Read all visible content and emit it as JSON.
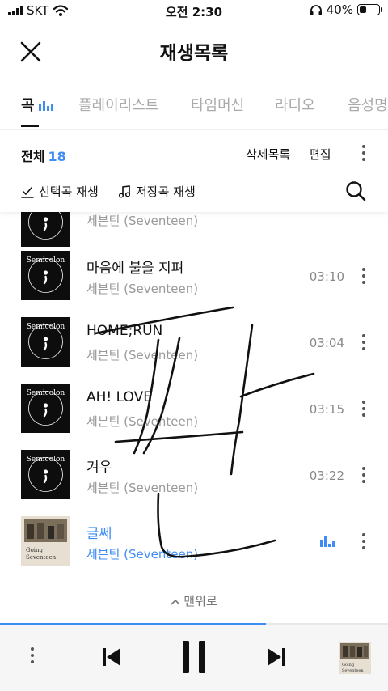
{
  "status_bar": {
    "carrier": "SKT",
    "time": "오전 2:30",
    "battery": "40%",
    "battery_level": 0.4
  },
  "header": {
    "title": "재생목록"
  },
  "tabs": [
    {
      "label": "곡",
      "active": true
    },
    {
      "label": "플레이리스트",
      "active": false
    },
    {
      "label": "타임머신",
      "active": false
    },
    {
      "label": "라디오",
      "active": false
    },
    {
      "label": "음성명",
      "active": false
    }
  ],
  "toolbar": {
    "count_label": "전체",
    "count": "18",
    "delete_label": "삭제목록",
    "edit_label": "편집"
  },
  "play_options": {
    "selected_play": "선택곡 재생",
    "saved_play": "저장곡 재생"
  },
  "songs": [
    {
      "title": "",
      "artist": "세븐틴 (Seventeen)",
      "duration": "",
      "cover": "semicolon"
    },
    {
      "title": "마음에 불을 지펴",
      "artist": "세븐틴 (Seventeen)",
      "duration": "03:10",
      "cover": "semicolon"
    },
    {
      "title": "HOME;RUN",
      "artist": "세븐틴 (Seventeen)",
      "duration": "03:04",
      "cover": "semicolon"
    },
    {
      "title": "AH! LOVE",
      "artist": "세븐틴 (Seventeen)",
      "duration": "03:15",
      "cover": "semicolon"
    },
    {
      "title": "겨우",
      "artist": "세븐틴 (Seventeen)",
      "duration": "03:22",
      "cover": "semicolon"
    },
    {
      "title": "글쎄",
      "artist": "세븐틴 (Seventeen)",
      "duration": "",
      "cover": "going-seventeen",
      "playing": true
    }
  ],
  "back_to_top": "맨위로",
  "cover_texts": {
    "semicolon": "Semicolon",
    "going_line1": "Going",
    "going_line2": "Seventeen"
  },
  "player": {
    "progress": 0.685
  },
  "colors": {
    "accent": "#3f8cf5"
  },
  "icons": [
    "close-icon",
    "equalizer-icon",
    "more-icon",
    "check-play-icon",
    "music-note-icon",
    "search-icon",
    "chevron-up-icon",
    "previous-icon",
    "pause-icon",
    "next-icon",
    "wifi-icon",
    "headphones-icon"
  ]
}
